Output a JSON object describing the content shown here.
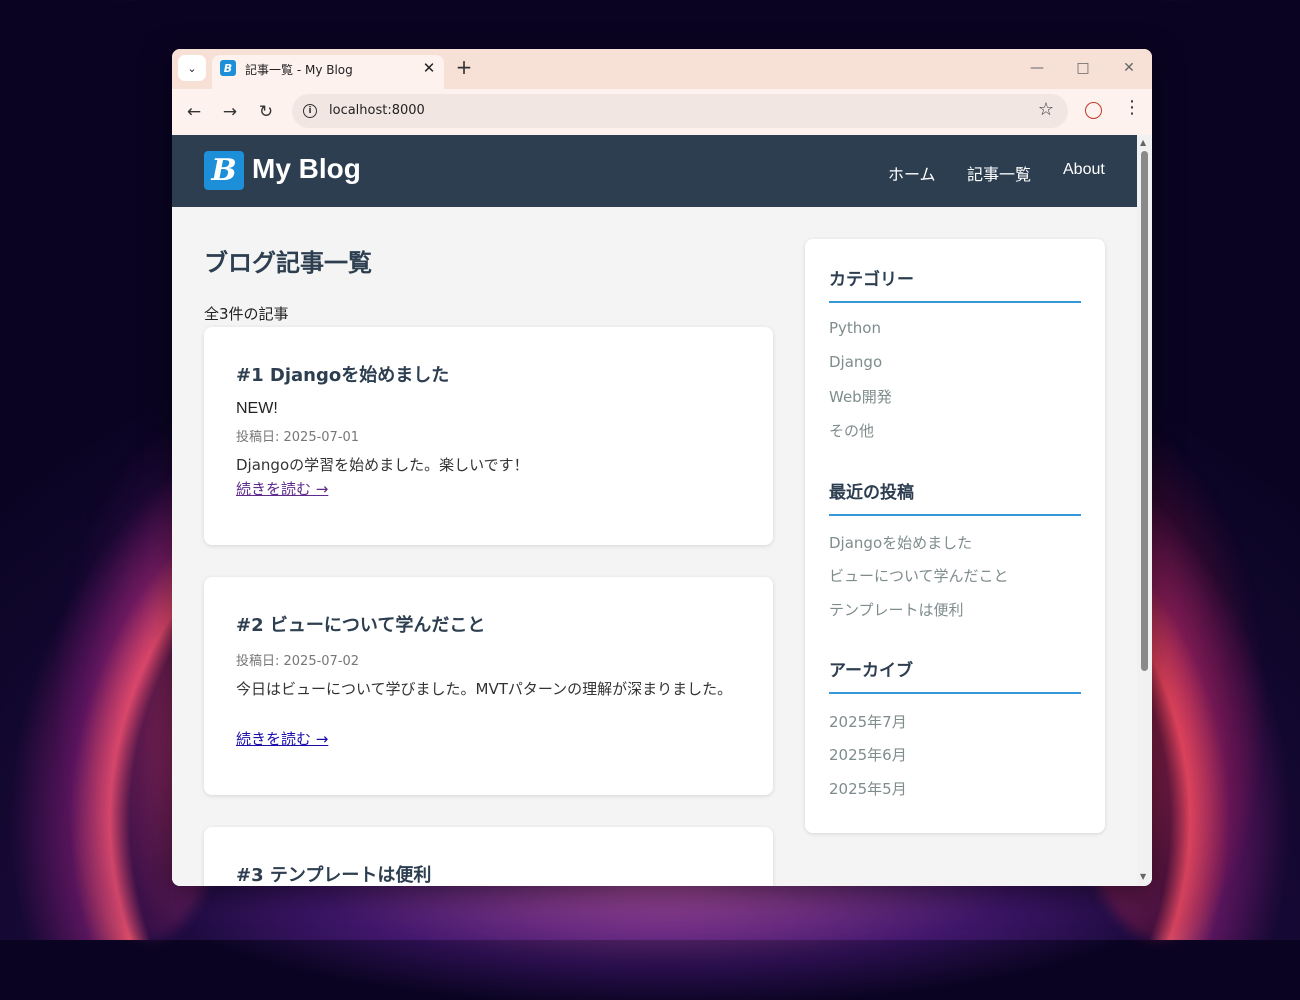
{
  "browser": {
    "tab_title": "記事一覧 - My Blog",
    "tab_favicon": "B",
    "url": "localhost:8000"
  },
  "site": {
    "logo_letter": "B",
    "title": "My Blog",
    "nav": [
      "ホーム",
      "記事一覧",
      "About"
    ]
  },
  "main": {
    "heading": "ブログ記事一覧",
    "count_text": "全3件の記事",
    "articles": [
      {
        "title": "#1 Djangoを始めました",
        "badge": "NEW!",
        "date": "投稿日: 2025-07-01",
        "excerpt": "Djangoの学習を始めました。楽しいです！",
        "link": "続きを読む →"
      },
      {
        "title": "#2 ビューについて学んだこと",
        "date": "投稿日: 2025-07-02",
        "excerpt": "今日はビューについて学びました。MVTパターンの理解が深まりました。",
        "link": "続きを読む →"
      },
      {
        "title": "#3 テンプレートは便利"
      }
    ]
  },
  "sidebar": {
    "categories": {
      "heading": "カテゴリー",
      "items": [
        "Python",
        "Django",
        "Web開発",
        "その他"
      ]
    },
    "recent": {
      "heading": "最近の投稿",
      "items": [
        "Djangoを始めました",
        "ビューについて学んだこと",
        "テンプレートは便利"
      ]
    },
    "archive": {
      "heading": "アーカイブ",
      "items": [
        "2025年7月",
        "2025年6月",
        "2025年5月"
      ]
    }
  },
  "colors": {
    "header_bg": "#2c3e50",
    "accent": "#3498db",
    "logo_bg": "#1c8fd8"
  }
}
